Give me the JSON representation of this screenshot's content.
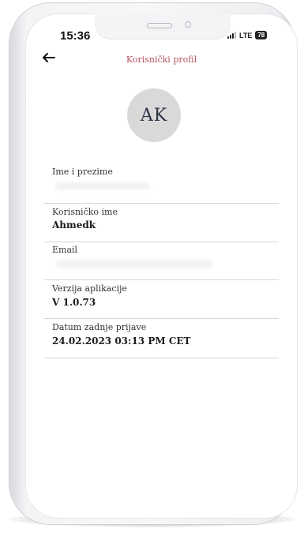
{
  "status_bar": {
    "time": "15:36",
    "network": "LTE",
    "battery": "78"
  },
  "header": {
    "title": "Korisnički profil",
    "back_icon": "arrow-left-icon"
  },
  "avatar": {
    "initials": "AK"
  },
  "fields": [
    {
      "label": "Ime i prezime",
      "value": ""
    },
    {
      "label": "Korisničko ime",
      "value": "Ahmedk"
    },
    {
      "label": "Email",
      "value": ""
    },
    {
      "label": "Verzija aplikacije",
      "value": "V 1.0.73"
    },
    {
      "label": "Datum zadnje prijave",
      "value": "24.02.2023 03:13 PM CET"
    }
  ],
  "colors": {
    "title": "#b5535c",
    "avatar_bg": "#d9d9d9",
    "avatar_text": "#2c3446",
    "divider": "#d6d6d6"
  }
}
